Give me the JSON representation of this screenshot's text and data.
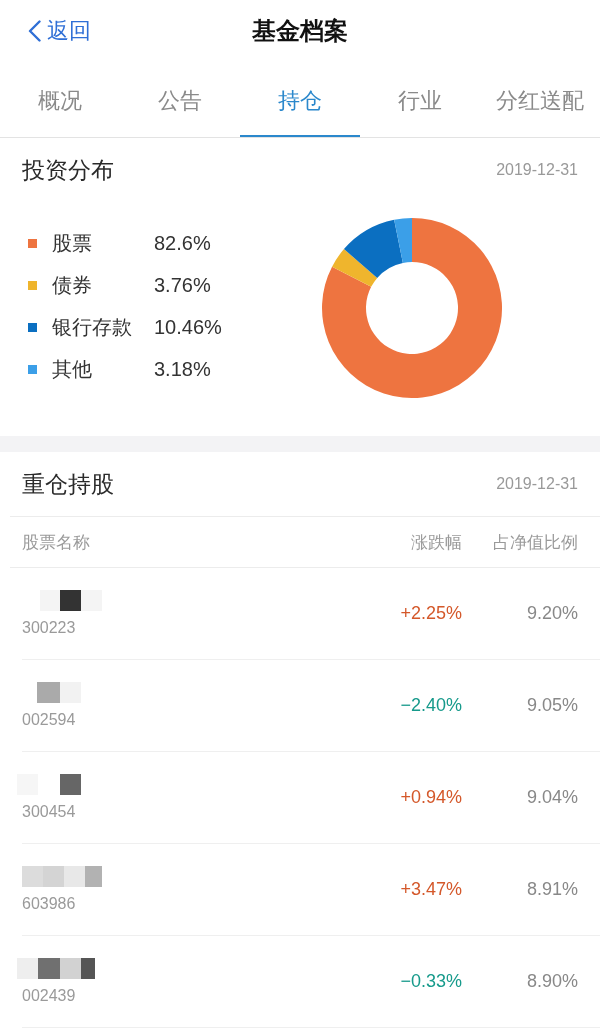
{
  "nav": {
    "back_label": "返回",
    "title": "基金档案"
  },
  "tabs": [
    {
      "label": "概况",
      "selected": false
    },
    {
      "label": "公告",
      "selected": false
    },
    {
      "label": "持仓",
      "selected": true
    },
    {
      "label": "行业",
      "selected": false
    },
    {
      "label": "分红送配",
      "selected": false
    }
  ],
  "allocation": {
    "title": "投资分布",
    "date": "2019-12-31",
    "items": [
      {
        "percent": "82.6%",
        "color": "#ee7440"
      },
      {
        "percent": "3.76%",
        "color": "#efb52d"
      },
      {
        "percent": "10.46%",
        "color": "#0b6fc1"
      },
      {
        "percent": "3.18%",
        "color": "#3b9fe8"
      }
    ],
    "chart_data": {
      "type": "donut",
      "categories": [
        "股票",
        "债券",
        "银行存款",
        "其他"
      ],
      "values": [
        82.6,
        3.76,
        10.46,
        3.18
      ]
    }
  },
  "holdings": {
    "title": "重仓持股",
    "date": "2019-12-31",
    "columns": [
      "股票名称",
      "涨跌幅",
      "占净值比例"
    ],
    "rows": [
      {
        "code": "300223",
        "change": "+2.25%",
        "color": "#d4582a",
        "ratio": "9.20%"
      },
      {
        "code": "002594",
        "change": "−2.40%",
        "color": "#169a8b",
        "ratio": "9.05%"
      },
      {
        "code": "300454",
        "change": "+0.94%",
        "color": "#d4582a",
        "ratio": "9.04%"
      },
      {
        "code": "603986",
        "change": "+3.47%",
        "color": "#d4582a",
        "ratio": "8.91%"
      },
      {
        "code": "002439",
        "change": "−0.33%",
        "color": "#169a8b",
        "ratio": "8.90%"
      }
    ]
  }
}
